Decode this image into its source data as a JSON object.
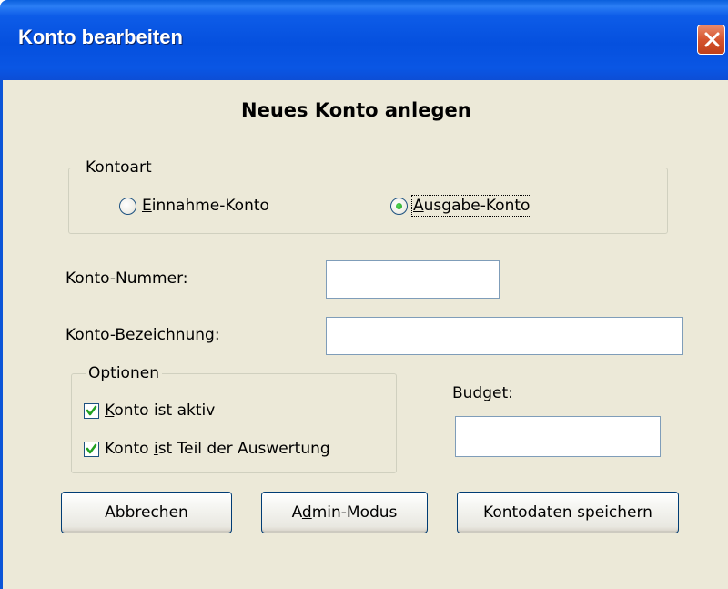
{
  "window": {
    "title": "Konto bearbeiten",
    "close_icon": "close-icon"
  },
  "heading": "Neues Konto anlegen",
  "kontoart": {
    "legend": "Kontoart",
    "options": [
      {
        "mnemonic": "E",
        "rest": "innahme-Konto",
        "selected": false
      },
      {
        "mnemonic": "A",
        "rest": "usgabe-Konto",
        "selected": true
      }
    ]
  },
  "fields": {
    "konto_nummer": {
      "label": "Konto-Nummer:",
      "value": ""
    },
    "konto_bezeichnung": {
      "label": "Konto-Bezeichnung:",
      "value": ""
    },
    "budget": {
      "label": "Budget:",
      "value": ""
    }
  },
  "optionen": {
    "legend": "Optionen",
    "items": [
      {
        "mnemonic": "K",
        "rest": "onto ist aktiv",
        "checked": true
      },
      {
        "before": "Konto ",
        "mnemonic": "i",
        "rest": "st Teil der Auswertung",
        "checked": true
      }
    ]
  },
  "buttons": {
    "cancel": "Abbrechen",
    "admin_before": "A",
    "admin_mnemonic": "d",
    "admin_after": "min-Modus",
    "save": "Kontodaten speichern"
  },
  "colors": {
    "titlebar": "#0550de",
    "dialog_bg": "#ece9d8",
    "check_green": "#21a121",
    "close_red": "#d5542e"
  }
}
